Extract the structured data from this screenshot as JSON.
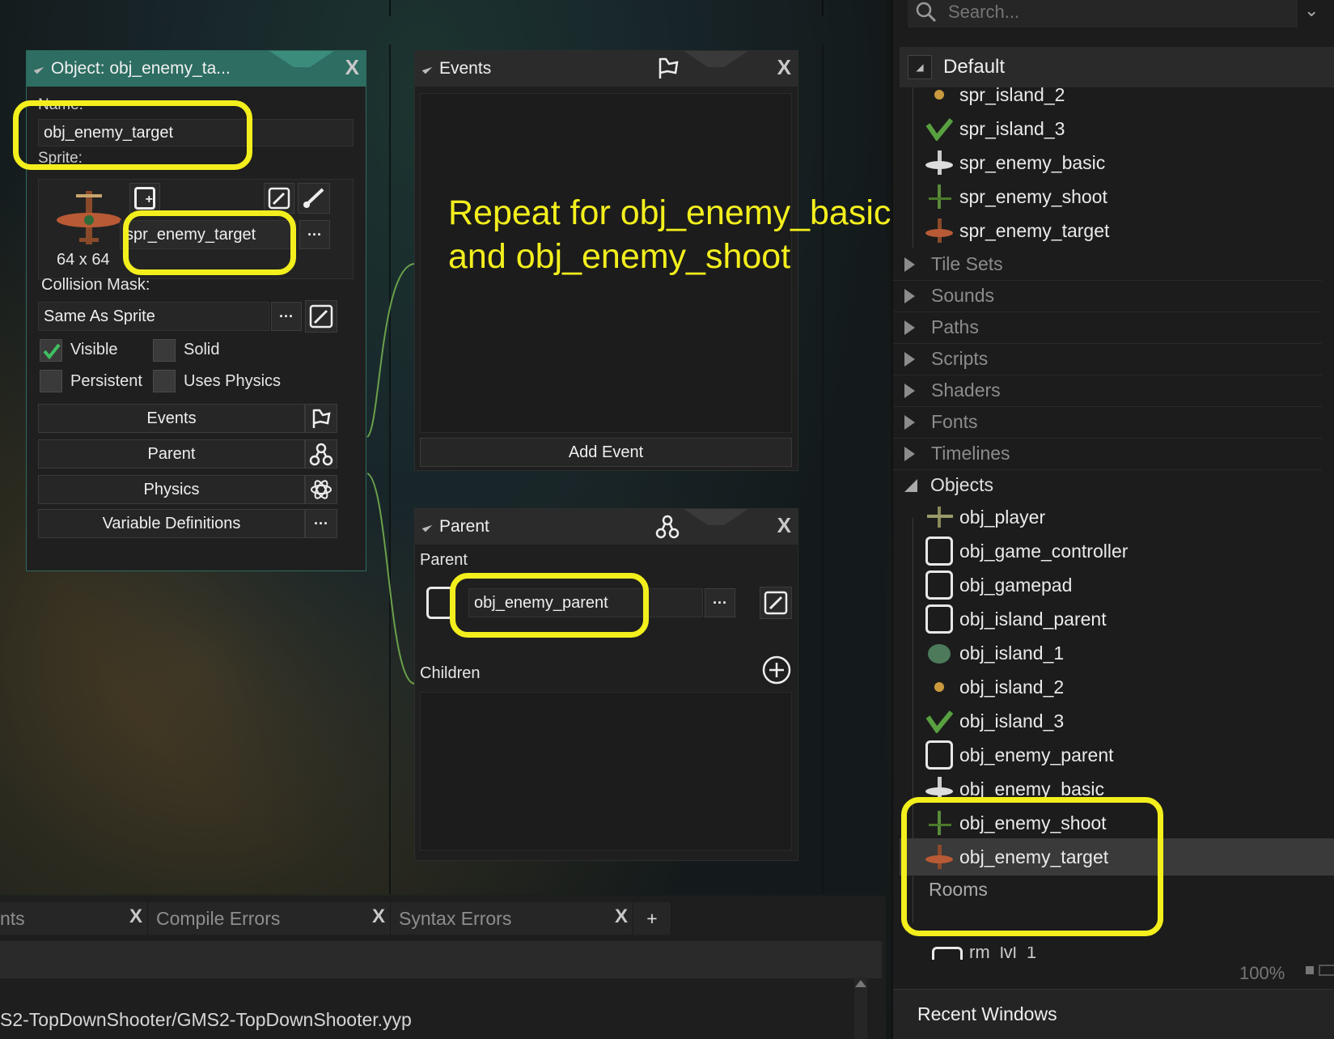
{
  "object_editor": {
    "title": "Object: obj_enemy_ta...",
    "name_label": "Name:",
    "name_value": "obj_enemy_target",
    "sprite_label": "Sprite:",
    "sprite_name": "spr_enemy_target",
    "sprite_size": "64 x 64",
    "collision_mask_label": "Collision Mask:",
    "collision_mask_value": "Same As Sprite",
    "visible_label": "Visible",
    "solid_label": "Solid",
    "persistent_label": "Persistent",
    "uses_physics_label": "Uses Physics",
    "visible_checked": true,
    "solid_checked": false,
    "persistent_checked": false,
    "uses_physics_checked": false,
    "events_button": "Events",
    "parent_button": "Parent",
    "physics_button": "Physics",
    "variable_definitions_button": "Variable Definitions",
    "ellipsis": "···"
  },
  "events_panel": {
    "title": "Events",
    "add_event_button": "Add Event"
  },
  "annotation": {
    "line1": "Repeat for obj_enemy_basic",
    "line2": "and obj_enemy_shoot",
    "color": "#f3ef1d"
  },
  "parent_panel": {
    "title": "Parent",
    "parent_label": "Parent",
    "parent_value": "obj_enemy_parent",
    "children_label": "Children"
  },
  "resource_tree": {
    "search_placeholder": "Search...",
    "group_label": "Default",
    "sprites": [
      "spr_island_2",
      "spr_island_3",
      "spr_enemy_basic",
      "spr_enemy_shoot",
      "spr_enemy_target"
    ],
    "categories": [
      "Tile Sets",
      "Sounds",
      "Paths",
      "Scripts",
      "Shaders",
      "Fonts",
      "Timelines"
    ],
    "objects_label": "Objects",
    "objects": [
      "obj_player",
      "obj_game_controller",
      "obj_gamepad",
      "obj_island_parent",
      "obj_island_1",
      "obj_island_2",
      "obj_island_3",
      "obj_enemy_parent",
      "obj_enemy_basic",
      "obj_enemy_shoot",
      "obj_enemy_target"
    ],
    "rooms_label": "Rooms",
    "room_partial": "rm_lvl_1",
    "zoom": "100%",
    "recent_windows": "Recent Windows"
  },
  "bottom_bar": {
    "tabs": [
      "nts",
      "Compile Errors",
      "Syntax Errors"
    ],
    "add_tab": "+",
    "path": "S2-TopDownShooter/GMS2-TopDownShooter.yyp"
  }
}
